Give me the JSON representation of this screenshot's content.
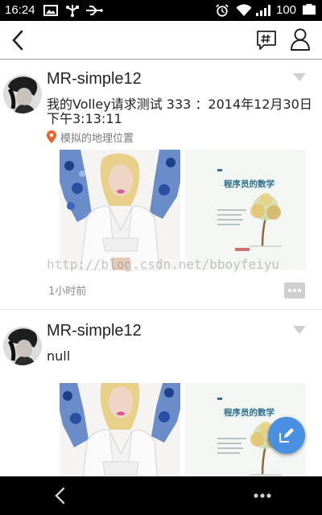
{
  "status_bar": {
    "time": "16:24",
    "battery": "100",
    "icons": [
      "image-icon",
      "usb-icon",
      "alarm-icon",
      "wifi-icon",
      "signal-icon",
      "battery-icon"
    ]
  },
  "app_bar": {
    "back_icon": "back-arrow-icon",
    "actions": [
      "hashtag-comment-icon",
      "user-icon"
    ]
  },
  "feed": {
    "posts": [
      {
        "username": "MR-simple12",
        "content": "我的Volley请求测试   333 ：2014年12月30日  下午3:13:11",
        "location": "模拟的地理位置",
        "time_ago": "1小时前",
        "images": [
          "woman-fashion-photo",
          "math-book-cover"
        ]
      },
      {
        "username": "MR-simple12",
        "content": "null",
        "images": [
          "woman-fashion-photo",
          "math-book-cover"
        ]
      }
    ],
    "book_title": "程序员的数学",
    "watermark": "http://blog.csdn.net/bboyfeiyu"
  },
  "colors": {
    "fab": "#4a90e2",
    "location_pin": "#f0602a",
    "divider": "#e3e3e3"
  }
}
